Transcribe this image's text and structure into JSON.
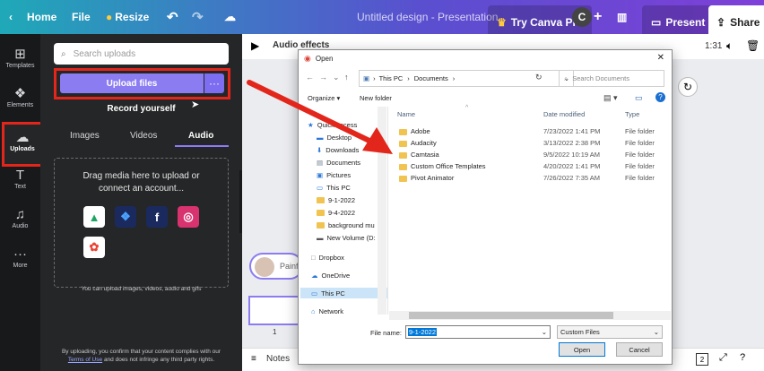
{
  "topbar": {
    "home": "Home",
    "file": "File",
    "resize": "Resize",
    "doc_title": "Untitled design - Presentation",
    "try_pro": "Try Canva Pro",
    "avatar": "C",
    "present": "Present",
    "share": "Share"
  },
  "rail": {
    "items": [
      {
        "label": "Templates",
        "icon": "templates-icon"
      },
      {
        "label": "Elements",
        "icon": "elements-icon"
      },
      {
        "label": "Uploads",
        "icon": "cloud-upload-icon"
      },
      {
        "label": "Text",
        "icon": "text-icon"
      },
      {
        "label": "Audio",
        "icon": "music-note-icon"
      },
      {
        "label": "More",
        "icon": "more-icon"
      }
    ]
  },
  "panel": {
    "search_placeholder": "Search uploads",
    "upload_files": "Upload files",
    "more": "···",
    "record_yourself": "Record yourself",
    "tabs": [
      "Images",
      "Videos",
      "Audio"
    ],
    "drop_text_1": "Drag media here to upload or",
    "drop_text_2": "connect an account...",
    "hint": "You can upload images, videos, audio and gifs",
    "footer_1": "By uploading, you confirm that your content complies with our",
    "footer_link": "Terms of Use",
    "footer_2": "and does not infringe any third party rights."
  },
  "editor": {
    "audio_effects": "Audio effects",
    "time": "1:31",
    "page_number": "1",
    "notes": "Notes",
    "track_label": "Painf",
    "pages_count": "2"
  },
  "dialog": {
    "title": "Open",
    "path": [
      "This PC",
      "Documents"
    ],
    "search_placeholder": "Search Documents",
    "organize": "Organize",
    "new_folder": "New folder",
    "columns": {
      "name": "Name",
      "date": "Date modified",
      "type": "Type"
    },
    "nav": [
      "Quick access",
      "Desktop",
      "Downloads",
      "Documents",
      "Pictures",
      "This PC",
      "9-1-2022",
      "9-4-2022",
      "background mu",
      "New Volume (D:",
      "Dropbox",
      "OneDrive",
      "This PC",
      "Network"
    ],
    "files": [
      {
        "name": "Adobe",
        "date": "7/23/2022 1:41 PM",
        "type": "File folder"
      },
      {
        "name": "Audacity",
        "date": "3/13/2022 2:38 PM",
        "type": "File folder"
      },
      {
        "name": "Camtasia",
        "date": "9/5/2022 10:19 AM",
        "type": "File folder"
      },
      {
        "name": "Custom Office Templates",
        "date": "4/20/2022 1:41 PM",
        "type": "File folder"
      },
      {
        "name": "Pivot Animator",
        "date": "7/26/2022 7:35 AM",
        "type": "File folder"
      }
    ],
    "file_name_label": "File name:",
    "file_name_value": "9-1-2022",
    "file_type": "Custom Files",
    "open": "Open",
    "cancel": "Cancel"
  },
  "colors": {
    "annotation": "#e3261c",
    "accent": "#8b7cf2"
  }
}
